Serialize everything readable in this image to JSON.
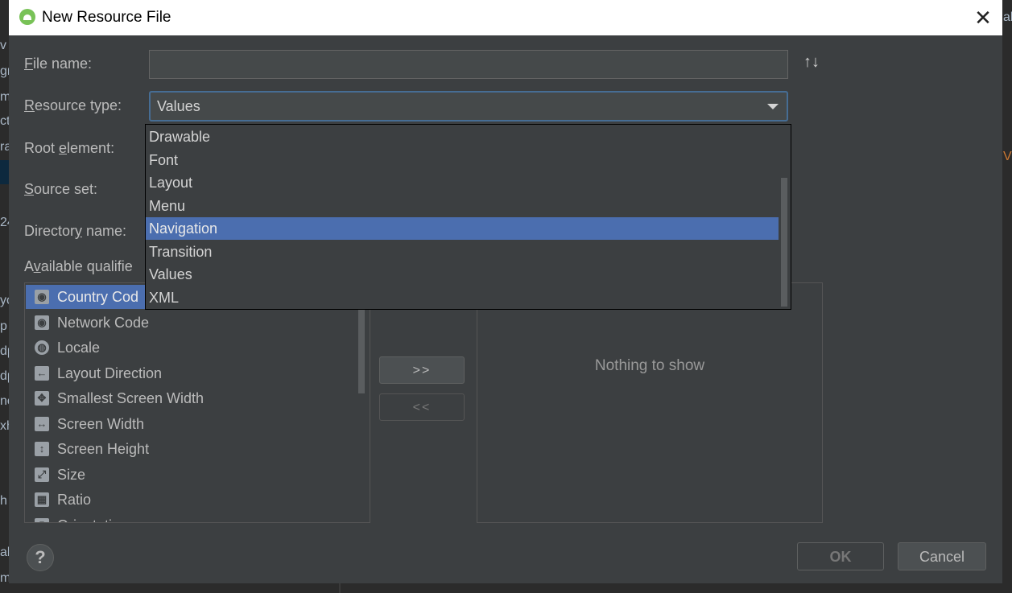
{
  "dialog": {
    "title": "New Resource File",
    "close_glyph": "✕"
  },
  "form": {
    "file_name": {
      "label_mnemonic": "F",
      "label_rest": "ile name:",
      "value": ""
    },
    "sort_glyph": "↑↓",
    "resource_type": {
      "label_mnemonic": "R",
      "label_rest": "esource type:",
      "value": "Values"
    },
    "root_element": {
      "label_pre": "Root ",
      "label_mnemonic": "e",
      "label_rest": "lement:"
    },
    "source_set": {
      "label_mnemonic": "S",
      "label_rest": "ource set:"
    },
    "directory_name": {
      "label_pre": "Director",
      "label_mnemonic": "y",
      "label_rest": " name:"
    },
    "available_qualifiers": {
      "label_pre": "A",
      "label_mnemonic": "v",
      "label_rest": "ailable qualifie"
    }
  },
  "resource_type_options": [
    "Drawable",
    "Font",
    "Layout",
    "Menu",
    "Navigation",
    "Transition",
    "Values",
    "XML"
  ],
  "resource_type_highlighted": "Navigation",
  "qualifiers": [
    {
      "label": "Country Cod",
      "icon": "sim-globe-icon",
      "glyph": "◉"
    },
    {
      "label": "Network Code",
      "icon": "sim-network-icon",
      "glyph": "◉"
    },
    {
      "label": "Locale",
      "icon": "globe-icon",
      "glyph": "◍"
    },
    {
      "label": "Layout Direction",
      "icon": "arrow-left-icon",
      "glyph": "←"
    },
    {
      "label": "Smallest Screen Width",
      "icon": "expand-arrows-icon",
      "glyph": "✥"
    },
    {
      "label": "Screen Width",
      "icon": "horizontal-arrows-icon",
      "glyph": "↔"
    },
    {
      "label": "Screen Height",
      "icon": "vertical-arrows-icon",
      "glyph": "↕"
    },
    {
      "label": "Size",
      "icon": "diagonal-resize-icon",
      "glyph": "⤢"
    },
    {
      "label": "Ratio",
      "icon": "ratio-icon",
      "glyph": "▦"
    },
    {
      "label": "Orientation",
      "icon": "orientation-icon",
      "glyph": "▯"
    }
  ],
  "buttons": {
    "add": ">>",
    "remove": "<<",
    "ok": "OK",
    "cancel": "Cancel",
    "help": "?"
  },
  "chosen_qualifiers": {
    "empty_text": "Nothing to show"
  },
  "background_fragments": {
    "left": [
      "v",
      "gr",
      "m",
      "ct",
      "ra",
      "24",
      "yo",
      "p",
      "dp",
      "dp",
      "nc",
      "xh",
      "h",
      "al",
      "m"
    ],
    "right": [
      "al",
      "V"
    ]
  },
  "colors": {
    "selection": "#4b6eaf",
    "focus_border": "#466d94",
    "dialog_bg": "#3c3f41"
  }
}
